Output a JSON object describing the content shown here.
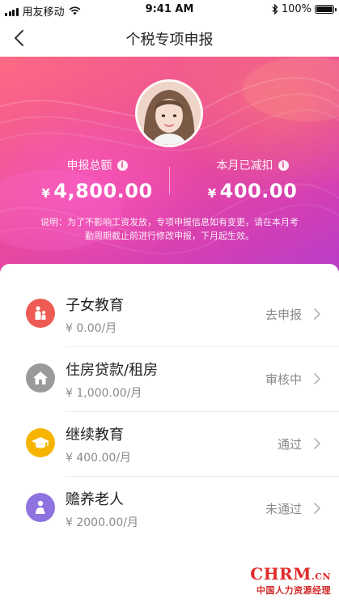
{
  "status_bar": {
    "carrier": "用友移动",
    "time": "9:41 AM",
    "battery": "100%"
  },
  "nav": {
    "title": "个税专项申报",
    "back_icon": "chevron-left-icon"
  },
  "summary": {
    "total_label": "申报总额",
    "total_currency": "¥",
    "total_value": "4,800.00",
    "deducted_label": "本月已减扣",
    "deducted_currency": "¥",
    "deducted_value": "400.00",
    "info_icon": "info-icon",
    "note": "说明：为了不影响工资发放，专项申报信息如有变更，请在本月考勤周期截止前进行修改申报，下月起生效。"
  },
  "colors": {
    "hero_start": "#ff6a83",
    "hero_end": "#b33ccc",
    "child_edu": "#ee5a54",
    "housing": "#9a9a9a",
    "continuing_edu": "#f6b400",
    "elderly": "#8e72e0"
  },
  "items": [
    {
      "title": "子女教育",
      "amount": "¥ 0.00/月",
      "status": "去申报",
      "icon": "family-icon"
    },
    {
      "title": "住房贷款/租房",
      "amount": "¥ 1,000.00/月",
      "status": "审核中",
      "icon": "house-icon"
    },
    {
      "title": "继续教育",
      "amount": "¥ 400.00/月",
      "status": "通过",
      "icon": "graduation-cap-icon"
    },
    {
      "title": "赡养老人",
      "amount": "¥ 2000.00/月",
      "status": "未通过",
      "icon": "elderly-icon"
    }
  ],
  "watermark": {
    "logo": "CHRM",
    "suffix": ".CN",
    "subtitle": "中国人力资源经理"
  }
}
